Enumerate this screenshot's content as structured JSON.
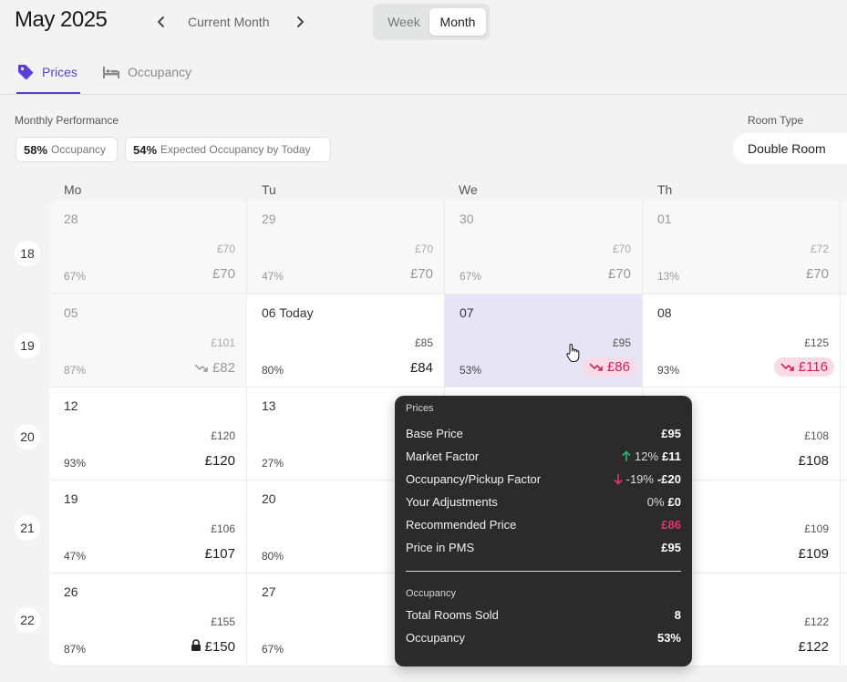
{
  "header": {
    "title": "May 2025",
    "current_month": "Current Month",
    "view_week": "Week",
    "view_month": "Month"
  },
  "tabs": [
    {
      "label": "Prices",
      "icon": "tag-icon",
      "active": true
    },
    {
      "label": "Occupancy",
      "icon": "bed-icon",
      "active": false
    }
  ],
  "performance": {
    "label": "Monthly Performance",
    "occupancy_value": "58%",
    "occupancy_label": "Occupancy",
    "expected_value": "54%",
    "expected_label": "Expected Occupancy by Today"
  },
  "room_type": {
    "label": "Room Type",
    "value": "Double Room"
  },
  "colors": {
    "accent": "#5b3fd6",
    "decrease": "#d21f5f",
    "increase": "#2bb673",
    "tooltip_bg": "#2b2b2b"
  },
  "calendar": {
    "weekdays": [
      "Mo",
      "Tu",
      "We",
      "Th"
    ],
    "weeks": [
      "18",
      "19",
      "20",
      "21",
      "22"
    ],
    "cells": [
      {
        "day": "28",
        "base": "£70",
        "occ": "67%",
        "price": "£70"
      },
      {
        "day": "29",
        "base": "£70",
        "occ": "47%",
        "price": "£70"
      },
      {
        "day": "30",
        "base": "£70",
        "occ": "67%",
        "price": "£70"
      },
      {
        "day": "01",
        "base": "£72",
        "occ": "13%",
        "price": "£70"
      },
      {
        "day": "05",
        "base": "£101",
        "occ": "87%",
        "price": "£82"
      },
      {
        "day": "06 Today",
        "base": "£85",
        "occ": "80%",
        "price": "£84"
      },
      {
        "day": "07",
        "base": "£95",
        "occ": "53%",
        "price": "£86"
      },
      {
        "day": "08",
        "base": "£125",
        "occ": "93%",
        "price": "£116"
      },
      {
        "day": "12",
        "base": "£120",
        "occ": "93%",
        "price": "£120"
      },
      {
        "day": "13",
        "base": "",
        "occ": "27%",
        "price": ""
      },
      {
        "day": "",
        "base": "£108",
        "occ": "",
        "price": "£108"
      },
      {
        "day": "19",
        "base": "£106",
        "occ": "47%",
        "price": "£107"
      },
      {
        "day": "20",
        "base": "",
        "occ": "80%",
        "price": ""
      },
      {
        "day": "",
        "base": "£109",
        "occ": "",
        "price": "£109"
      },
      {
        "day": "26",
        "base": "£155",
        "occ": "87%",
        "price": "£150"
      },
      {
        "day": "27",
        "base": "",
        "occ": "67%",
        "price": ""
      },
      {
        "day": "",
        "base": "£122",
        "occ": "",
        "price": "£122"
      }
    ]
  },
  "tooltip": {
    "prices_title": "Prices",
    "base_label": "Base Price",
    "base_value": "£95",
    "market_label": "Market Factor",
    "market_pct": "12%",
    "market_value": "£11",
    "occ_factor_label": "Occupancy/Pickup Factor",
    "occ_factor_pct": "-19%",
    "occ_factor_value": "-£20",
    "adj_label": "Your Adjustments",
    "adj_pct": "0%",
    "adj_value": "£0",
    "rec_label": "Recommended Price",
    "rec_value": "£86",
    "pms_label": "Price in PMS",
    "pms_value": "£95",
    "occupancy_title": "Occupancy",
    "sold_label": "Total Rooms Sold",
    "sold_value": "8",
    "occ_label": "Occupancy",
    "occ_value": "53%"
  }
}
